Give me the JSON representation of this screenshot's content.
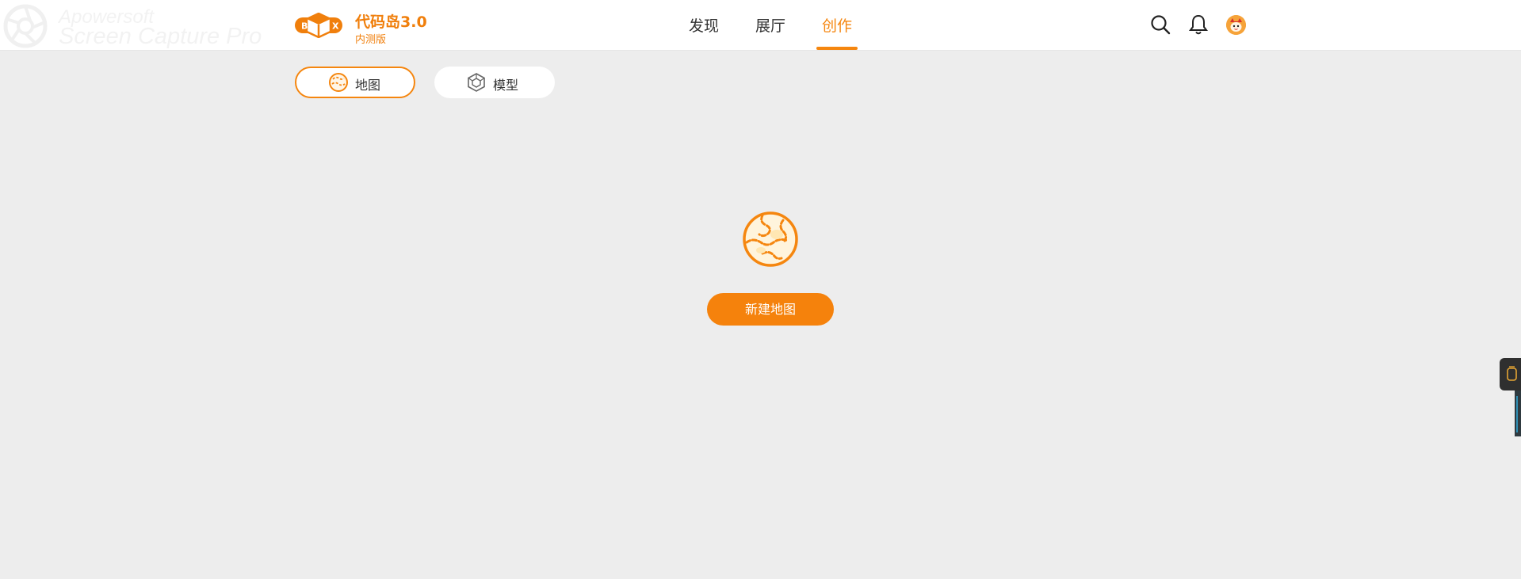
{
  "watermark": {
    "line1": "Apowersoft",
    "line2": "Screen Capture Pro"
  },
  "brand": {
    "title": "代码岛3.0",
    "subtitle": "内测版",
    "logo_letters": [
      "B",
      "X"
    ]
  },
  "nav": {
    "tabs": [
      {
        "label": "发现",
        "active": false
      },
      {
        "label": "展厅",
        "active": false
      },
      {
        "label": "创作",
        "active": true
      }
    ]
  },
  "header_icons": [
    "search-icon",
    "bell-icon",
    "avatar"
  ],
  "sub_tabs": [
    {
      "label": "地图",
      "icon": "globe-icon",
      "active": true
    },
    {
      "label": "模型",
      "icon": "cube-icon",
      "active": false
    }
  ],
  "main": {
    "illustration": "map-globe-icon",
    "new_button_label": "新建地图"
  },
  "colors": {
    "accent": "#f5860f",
    "background": "#ededed",
    "header": "#ffffff",
    "text": "#333333"
  }
}
